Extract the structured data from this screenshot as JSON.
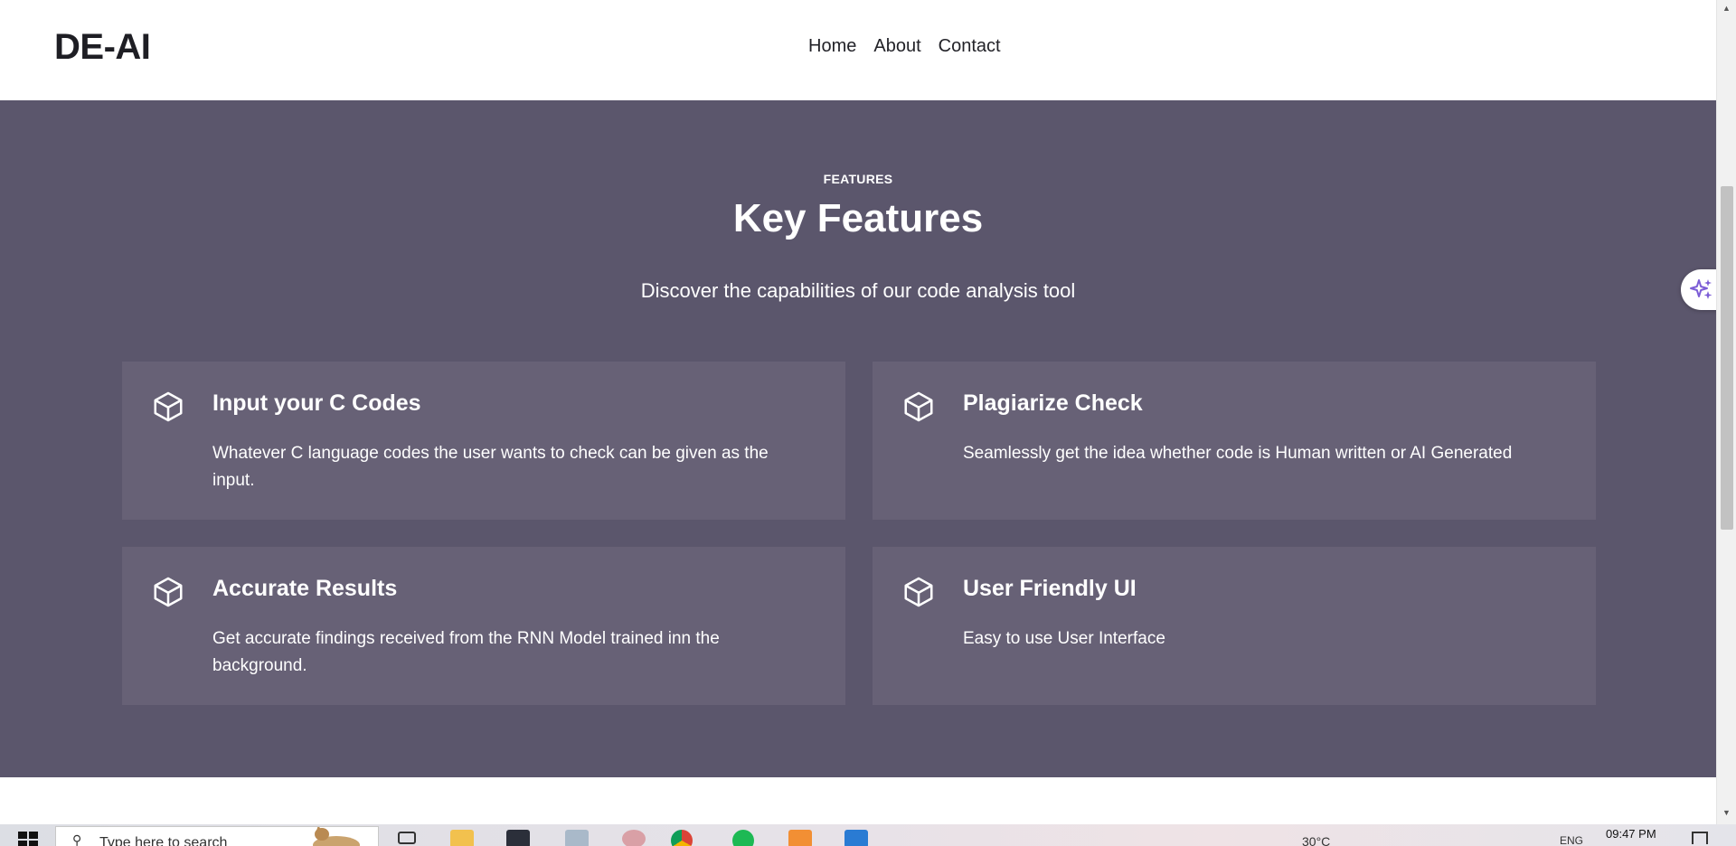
{
  "header": {
    "logo": "DE-AI",
    "nav": [
      {
        "label": "Home"
      },
      {
        "label": "About"
      },
      {
        "label": "Contact"
      }
    ]
  },
  "features": {
    "eyebrow": "FEATURES",
    "heading": "Key Features",
    "subheading": "Discover the capabilities of our code analysis tool",
    "cards": [
      {
        "icon": "cube-icon",
        "title": "Input your C Codes",
        "description": "Whatever C language codes the user wants to check can be given as the input."
      },
      {
        "icon": "cube-icon",
        "title": "Plagiarize Check",
        "description": "Seamlessly get the idea whether code is Human written or AI Generated"
      },
      {
        "icon": "cube-icon",
        "title": "Accurate Results",
        "description": "Get accurate findings received from the RNN Model trained inn the background."
      },
      {
        "icon": "cube-icon",
        "title": "User Friendly UI",
        "description": "Easy to use User Interface"
      }
    ]
  },
  "colors": {
    "section_bg": "#5b566c",
    "card_bg": "#676176",
    "assistant_accent": "#7b5cd6"
  },
  "taskbar": {
    "search_placeholder": "Type here to search",
    "weather": "30°C",
    "language": "ENG",
    "time": "09:47 PM",
    "icons": [
      "task-view-icon",
      "file-explorer-icon",
      "terminal-icon",
      "notepad-icon",
      "app-icon",
      "chrome-icon",
      "spotify-icon",
      "xampp-icon",
      "vscode-icon"
    ]
  }
}
